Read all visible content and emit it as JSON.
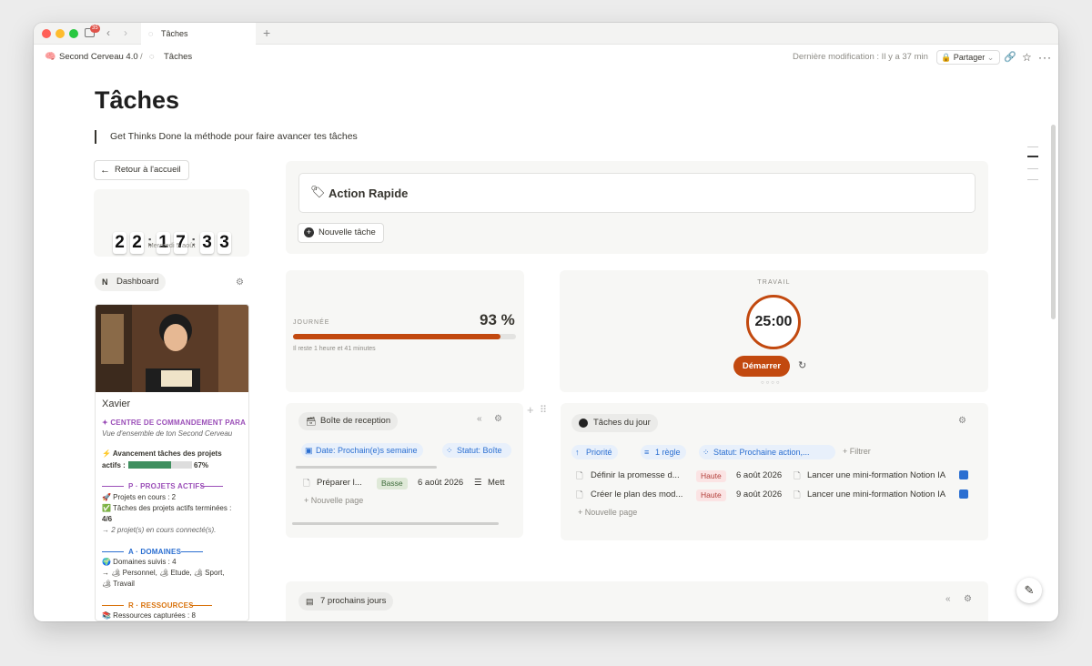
{
  "browser": {
    "tab_title": "Tâches",
    "notif_count": "35",
    "new_tab": "+"
  },
  "topbar": {
    "workspace": "Second Cerveau 4.0",
    "separator": "/",
    "page": "Tâches",
    "last_modified": "Dernière modification : Il y a 37 min",
    "share": "Partager"
  },
  "page": {
    "title": "Tâches",
    "quote": "Get Thinks Done la méthode pour faire avancer tes tâches"
  },
  "sidebar": {
    "back_button": "Retour à l'accueil",
    "clock": [
      "2",
      "2",
      "1",
      "7",
      "3",
      "3"
    ],
    "date": "Mercredi 5 août",
    "dashboard_label": "Dashboard",
    "profile_name": "Xavier",
    "command_title": "✦ CENTRE DE COMMANDEMENT PARA",
    "command_subtitle": "Vue d'ensemble de ton Second Cerveau",
    "progress_label": "⚡ Avancement tâches des projets",
    "progress_label2": "actifs :",
    "progress_value": "67%",
    "progress_fraction": 0.67,
    "projects_title": "P · PROJETS ACTIFS",
    "projects_current": "🚀 Projets en cours : 2",
    "projects_done": "✅ Tâches des projets actifs terminées :",
    "projects_done_value": "4/6",
    "projects_connected": "→ 2 projet(s) en cours connecté(s).",
    "domains_title": "A · DOMAINES",
    "domains_followed": "🌍 Domaines suivis : 4",
    "domains_list": "→ 🏕 Personnel, 🏕 Etude, 🏕 Sport,",
    "domains_list2": "🏕 Travail",
    "resources_title": "R · RESSOURCES",
    "resources_captured": "📚 Ressources capturées : 8"
  },
  "quick_action": {
    "title": "Action Rapide",
    "new_task": "Nouvelle tâche"
  },
  "day": {
    "label": "JOURNÉE",
    "percent": "93 %",
    "fraction": 0.93,
    "remaining": "Il reste 1 heure et 41 minutes"
  },
  "pomodoro": {
    "label": "TRAVAIL",
    "time": "25:00",
    "start": "Démarrer"
  },
  "inbox": {
    "title": "Boîte de reception",
    "filter_date": "Date: Prochain(e)s semaine",
    "filter_status": "Statut: Boîte",
    "row_name": "Préparer l...",
    "row_priority": "Basse",
    "row_date": "6 août 2026",
    "row_extra": "Mett",
    "new_page": "Nouvelle page"
  },
  "today": {
    "title": "Tâches du jour",
    "filter_priority": "Priorité",
    "filter_rule": "1 règle",
    "filter_status": "Statut: Prochaine action,...",
    "filter_add": "Filtrer",
    "rows": [
      {
        "name": "Définir la promesse d...",
        "priority": "Haute",
        "date": "6 août 2026",
        "project": "Lancer une mini-formation Notion IA"
      },
      {
        "name": "Créer le plan des mod...",
        "priority": "Haute",
        "date": "9 août 2026",
        "project": "Lancer une mini-formation Notion IA"
      }
    ],
    "new_page": "Nouvelle page"
  },
  "next_days": {
    "title": "7 prochains jours"
  },
  "colors": {
    "accent_orange": "#c2490f",
    "para_purple": "#9b4fb8",
    "domains_blue": "#2b6fd1",
    "resources_orange": "#d9730d",
    "progress_green": "#3f8f5f"
  }
}
